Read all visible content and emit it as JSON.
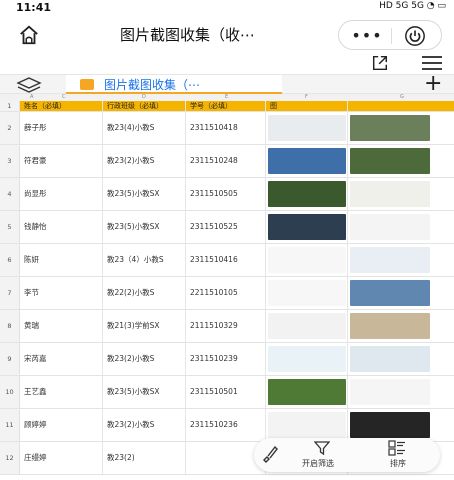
{
  "status": {
    "time": "11:41",
    "indicators": "HD 5G  5G  ◔  ▭"
  },
  "titlebar": {
    "title": "图片截图收集（收⋯",
    "more_label": "•••"
  },
  "tabs": {
    "active_sheet": "图片截图收集（⋯"
  },
  "columns": {
    "letters": [
      "A",
      "C",
      "D",
      "E",
      "F",
      "G"
    ]
  },
  "header_row": {
    "row_num": "1",
    "name": "姓名（必填）",
    "class": "行政班级（必填）",
    "id": "学号（必填）",
    "pic1": "图",
    "pic2": ""
  },
  "rows": [
    {
      "num": "2",
      "name": "薛子彤",
      "class": "教23(4)小教S",
      "id": "2311510418"
    },
    {
      "num": "3",
      "name": "符君豪",
      "class": "教23(2)小教S",
      "id": "2311510248"
    },
    {
      "num": "4",
      "name": "尚显彤",
      "class": "教23(5)小教SX",
      "id": "2311510505"
    },
    {
      "num": "5",
      "name": "钱静怡",
      "class": "教23(5)小教SX",
      "id": "2311510525"
    },
    {
      "num": "6",
      "name": "陈妍",
      "class": "教23（4）小教S",
      "id": "2311510416"
    },
    {
      "num": "7",
      "name": "李节",
      "class": "教22(2)小教S",
      "id": "2211510105"
    },
    {
      "num": "8",
      "name": "黄瑞",
      "class": "教21(3)学前SX",
      "id": "2111510329"
    },
    {
      "num": "9",
      "name": "宋芮嘉",
      "class": "教23(2)小教S",
      "id": "2311510239"
    },
    {
      "num": "10",
      "name": "王艺鑫",
      "class": "教23(5)小教SX",
      "id": "2311510501"
    },
    {
      "num": "11",
      "name": "顾婷婷",
      "class": "教23(2)小教S",
      "id": "2311510236"
    },
    {
      "num": "12",
      "name": "庄缦婷",
      "class": "教23(2)",
      "id": ""
    }
  ],
  "floatbar": {
    "filter_label": "开启筛选",
    "sort_label": "排序"
  },
  "colors": {
    "accent": "#f5a623",
    "header_row": "#f5b400",
    "link": "#1a73e8"
  },
  "icons": [
    "home-icon",
    "power-icon",
    "share-icon",
    "menu-icon",
    "layers-icon",
    "plus-icon",
    "brush-icon",
    "filter-icon",
    "sort-icon"
  ]
}
